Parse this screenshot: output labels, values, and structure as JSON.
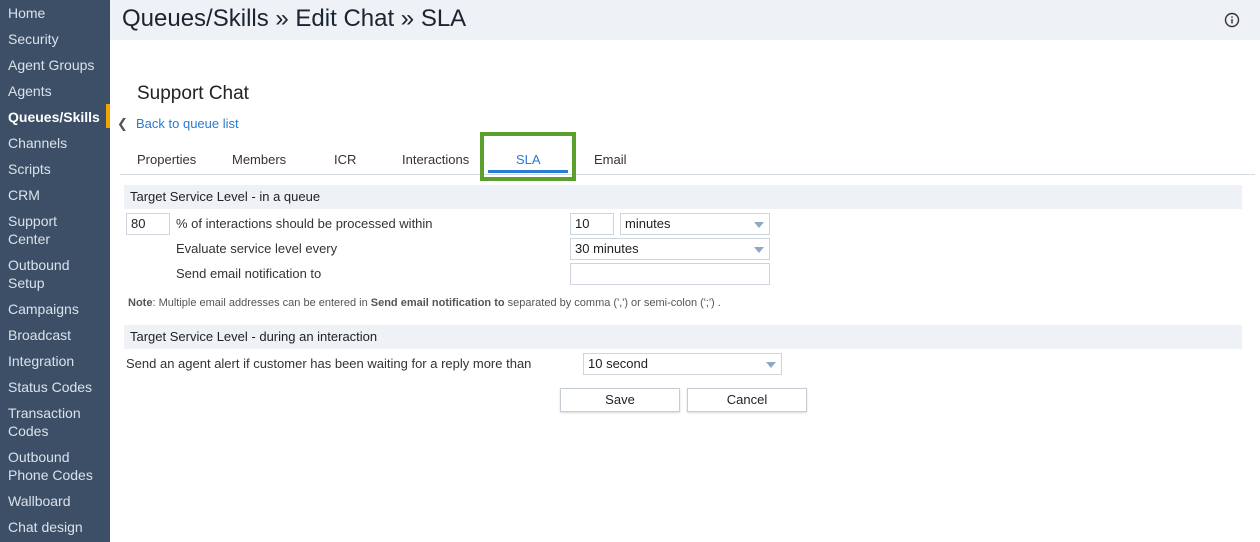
{
  "sidebar": {
    "items": [
      {
        "label": "Home"
      },
      {
        "label": "Security"
      },
      {
        "label": "Agent Groups"
      },
      {
        "label": "Agents"
      },
      {
        "label": "Queues/Skills"
      },
      {
        "label": "Channels"
      },
      {
        "label": "Scripts"
      },
      {
        "label": "CRM"
      },
      {
        "label": "Support Center"
      },
      {
        "label": "Outbound Setup"
      },
      {
        "label": "Campaigns"
      },
      {
        "label": "Broadcast"
      },
      {
        "label": "Integration"
      },
      {
        "label": "Status Codes"
      },
      {
        "label": "Transaction Codes"
      },
      {
        "label": "Outbound Phone Codes"
      },
      {
        "label": "Wallboard"
      },
      {
        "label": "Chat design"
      }
    ],
    "active": "Queues/Skills",
    "active_color": "#f0a500"
  },
  "header": {
    "title": "Queues/Skills » Edit Chat » SLA",
    "info_icon": "info-icon"
  },
  "page": {
    "queue_name": "Support Chat",
    "back_link": "Back to queue list"
  },
  "tabs": [
    {
      "label": "Properties"
    },
    {
      "label": "Members"
    },
    {
      "label": "ICR"
    },
    {
      "label": "Interactions"
    },
    {
      "label": "SLA"
    },
    {
      "label": "Email"
    }
  ],
  "active_tab": "SLA",
  "queue_section": {
    "title": "Target Service Level - in a queue",
    "percent_value": "80",
    "percent_label": "% of interactions should be processed within",
    "within_value": "10",
    "within_unit": "minutes",
    "evaluate_label": "Evaluate service level every",
    "evaluate_value": "30 minutes",
    "email_label": "Send email notification to",
    "email_value": ""
  },
  "note": {
    "prefix": "Note",
    "text1": ": Multiple email addresses can be entered in ",
    "bold": "Send email notification to",
    "text2": " separated by comma (',') or semi-colon (';') ."
  },
  "interaction_section": {
    "title": "Target Service Level - during an interaction",
    "alert_label": "Send an agent alert if customer has been waiting for a reply more than",
    "alert_value": "10 second"
  },
  "buttons": {
    "save": "Save",
    "cancel": "Cancel"
  },
  "colors": {
    "sidebar_bg": "#3d4f66",
    "link": "#2a7bd1",
    "highlight": "#5aa02c"
  }
}
